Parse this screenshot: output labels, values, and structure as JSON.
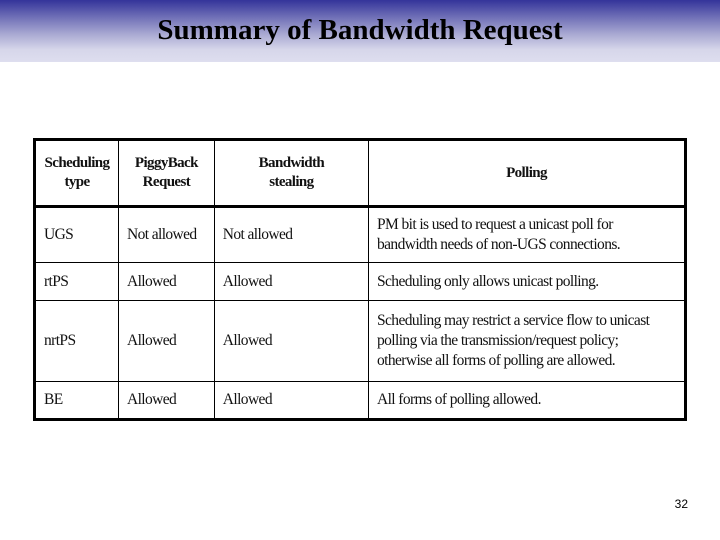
{
  "slide": {
    "title": "Summary of Bandwidth Request",
    "page_number": "32",
    "colors": {
      "title_band_top": "#34349a",
      "title_band_bottom": "#dedeef"
    }
  },
  "table": {
    "headers": [
      {
        "line1": "Scheduling",
        "line2": "type"
      },
      {
        "line1": "PiggyBack",
        "line2": "Request"
      },
      {
        "line1": "Bandwidth",
        "line2": "stealing"
      },
      {
        "line1": "Polling",
        "line2": ""
      }
    ],
    "rows": [
      {
        "type": "UGS",
        "piggyback": "Not allowed",
        "stealing": "Not allowed",
        "polling": "PM bit is used to request a unicast poll for bandwidth needs of non-UGS connections."
      },
      {
        "type": "rtPS",
        "piggyback": "Allowed",
        "stealing": "Allowed",
        "polling": "Scheduling only allows unicast polling."
      },
      {
        "type": "nrtPS",
        "piggyback": "Allowed",
        "stealing": "Allowed",
        "polling": "Scheduling may restrict a service flow to unicast polling via the transmission/request policy; otherwise all forms of polling are allowed."
      },
      {
        "type": "BE",
        "piggyback": "Allowed",
        "stealing": "Allowed",
        "polling": "All forms of polling allowed."
      }
    ]
  }
}
